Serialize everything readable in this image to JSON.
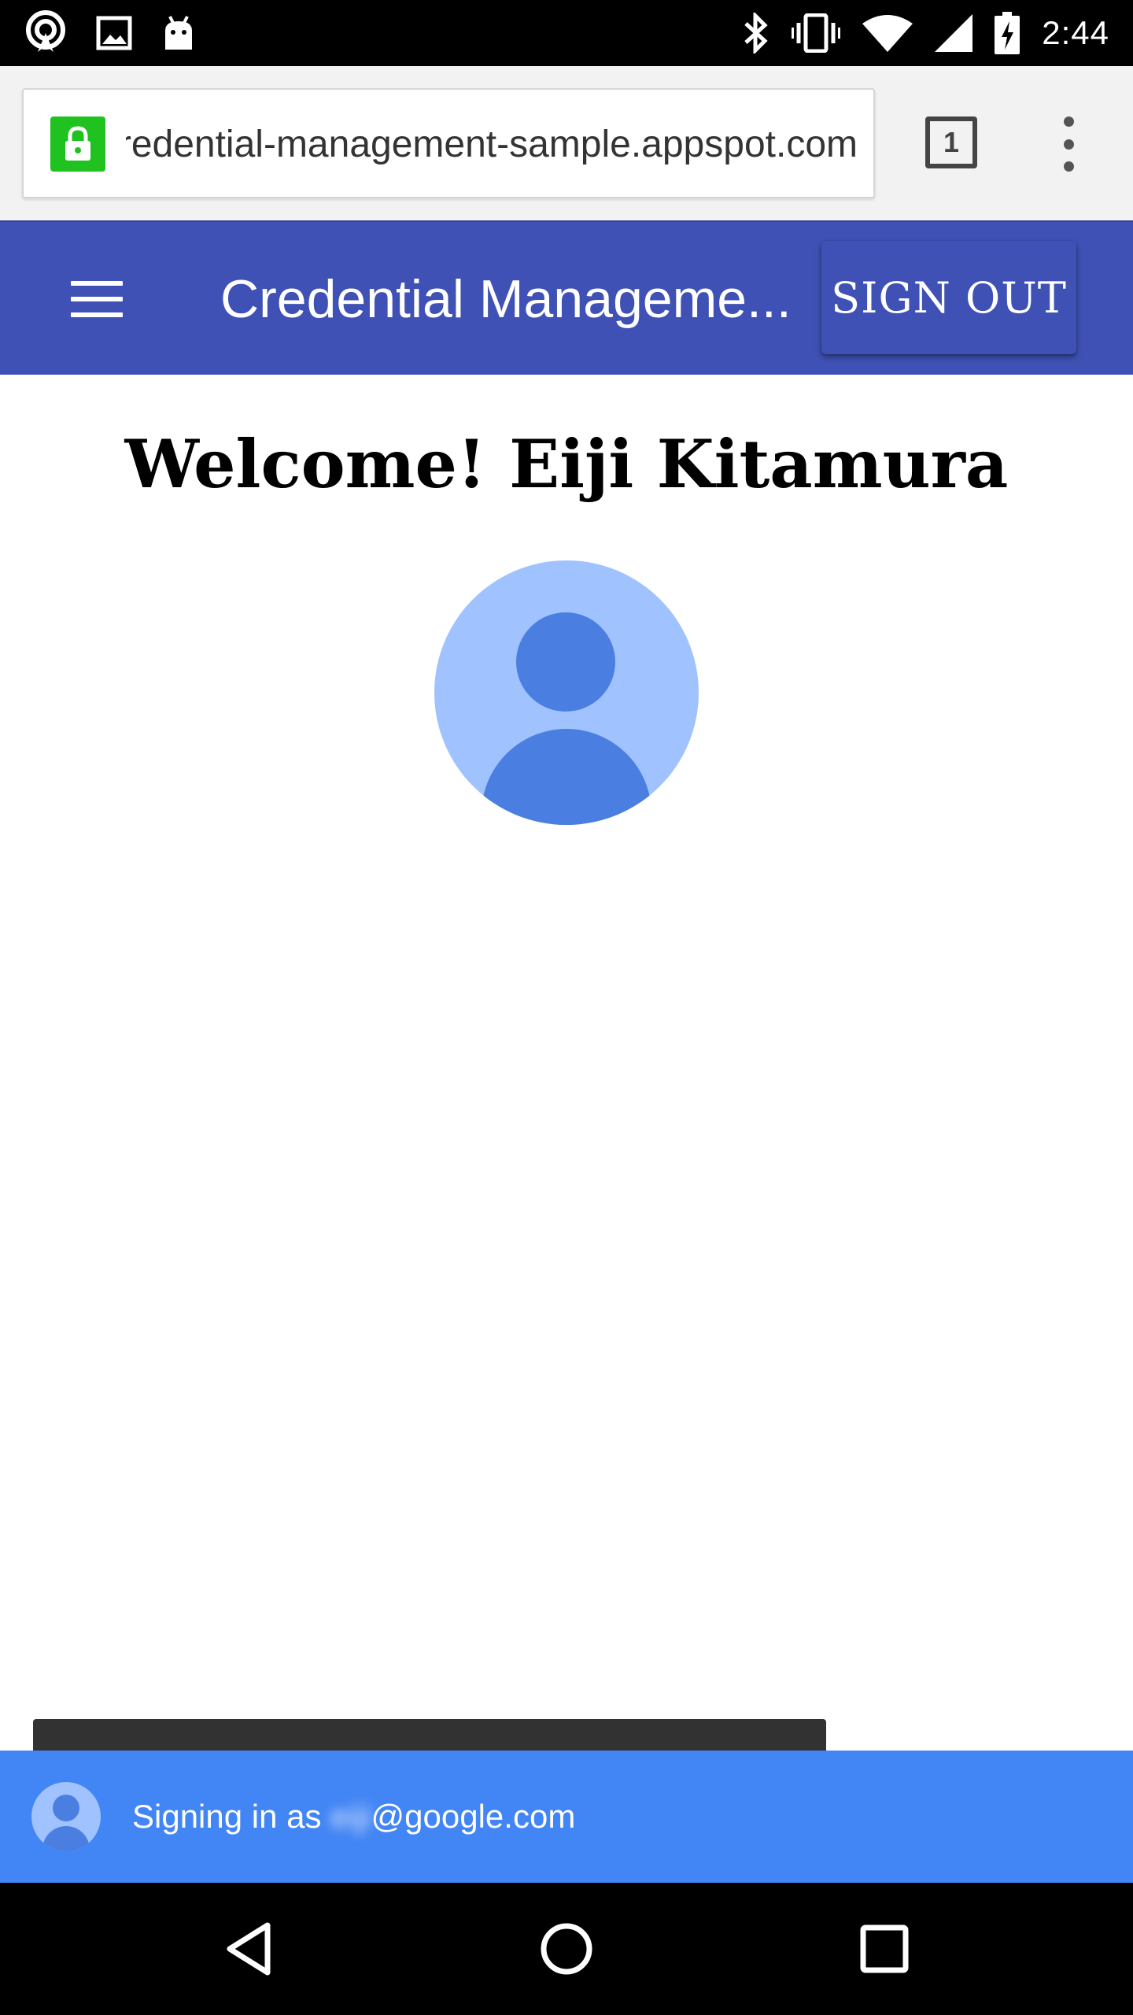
{
  "status_bar": {
    "time": "2:44",
    "left_icons": [
      "hotspot-icon",
      "image-icon",
      "android-icon"
    ],
    "right_icons": [
      "bluetooth-icon",
      "vibrate-icon",
      "wifi-icon",
      "cell-signal-icon",
      "battery-charging-icon"
    ]
  },
  "browser": {
    "url": "credential-management-sample.appspot.com",
    "tab_count": "1",
    "lock_color": "#1fc21f"
  },
  "app_header": {
    "title": "Credential Manageme...",
    "sign_out_label": "SIGN OUT",
    "color": "#3f51b5"
  },
  "main": {
    "welcome": "Welcome! Eiji Kitamura"
  },
  "signin_bar": {
    "prefix": "Signing in as ",
    "email_user": "eiji",
    "email_domain": "@google.com",
    "color": "#4285f4"
  },
  "nav_bar": {
    "buttons": [
      "back-icon",
      "home-icon",
      "recents-icon"
    ]
  }
}
